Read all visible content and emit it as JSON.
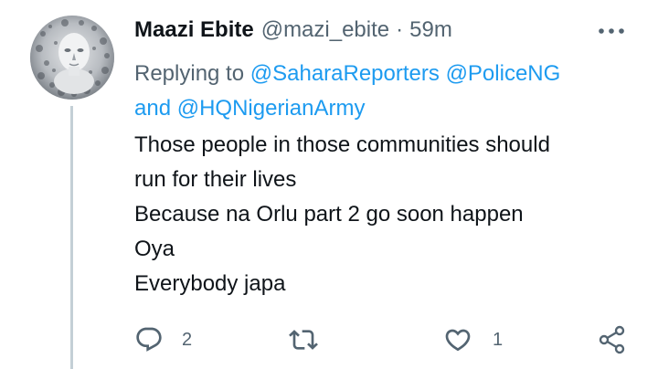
{
  "tweet": {
    "display_name": "Maazi Ebite",
    "handle": "@mazi_ebite",
    "separator": "·",
    "time": "59m",
    "replying_prefix": "Replying to",
    "mentions": [
      "@SaharaReporters",
      "@PoliceNG",
      "@HQNigerianArmy"
    ],
    "replying_conjunction": "and",
    "body_lines": [
      "Those people in those communities should",
      "run for their lives",
      "Because na Orlu part 2 go soon happen",
      "Oya",
      "Everybody japa"
    ],
    "actions": {
      "reply_count": "2",
      "retweet_count": "",
      "like_count": "1"
    }
  },
  "icons": {
    "more": "more-dots-icon",
    "reply": "speech-bubble-icon",
    "retweet": "retweet-arrows-icon",
    "like": "heart-icon",
    "share": "share-icon"
  },
  "colors": {
    "text": "#0f1419",
    "secondary": "#536471",
    "link": "#1d9bf0",
    "thread_line": "#c4cfd6"
  }
}
